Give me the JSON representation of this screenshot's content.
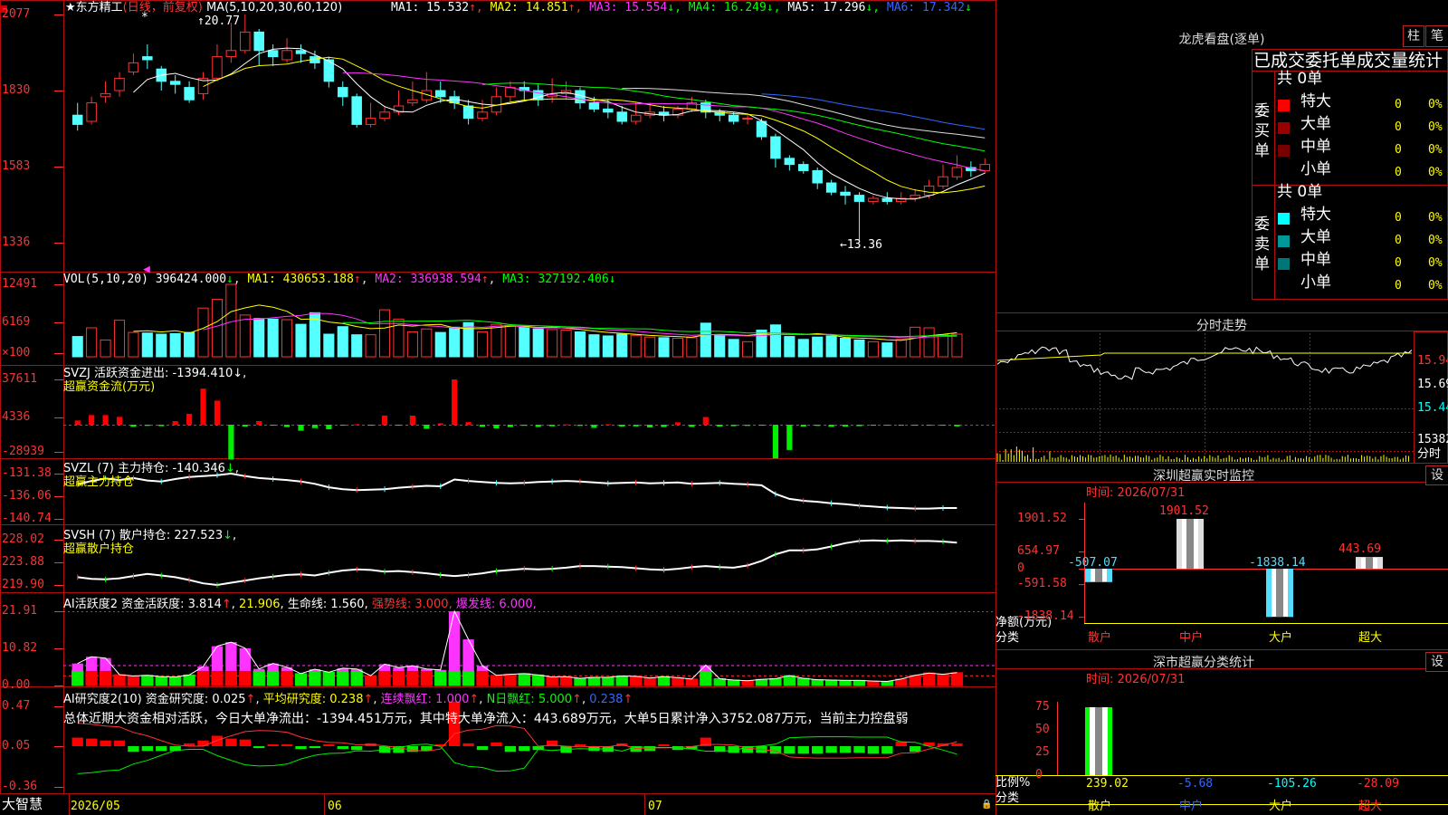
{
  "stock": {
    "star": "★",
    "name": "东方精工",
    "period": "(日线，前复权)",
    "ma_title": "MA(5,10,20,30,60,120)",
    "ma": [
      {
        "label": "MA1:",
        "value": "15.532",
        "arrow": "↑",
        "color": "#ffffff"
      },
      {
        "label": "MA2:",
        "value": "14.851",
        "arrow": "↑",
        "color": "#ffff00"
      },
      {
        "label": "MA3:",
        "value": "15.554",
        "arrow": "↓",
        "color": "#ff33ff"
      },
      {
        "label": "MA4:",
        "value": "16.249",
        "arrow": "↓",
        "color": "#00ff00"
      },
      {
        "label": "MA5:",
        "value": "17.296",
        "arrow": "↓",
        "color": "#ffffff"
      },
      {
        "label": "MA6:",
        "value": "17.342",
        "arrow": "↓",
        "color": "#3366ff"
      }
    ],
    "high_label": "20.77",
    "low_label": "13.36"
  },
  "price_axis": [
    "2077",
    "1830",
    "1583",
    "1336"
  ],
  "vol": {
    "title": "VOL(5,10,20)",
    "v": "396424.000",
    "ma1": "MA1: 430653.188",
    "ma2": "MA2: 336938.594",
    "ma3": "MA3: 327192.406",
    "axis": [
      "12491",
      "6169",
      "×100"
    ]
  },
  "svzj": {
    "title": "SVZJ  活跃资金进出: -1394.410",
    "sub": "超赢资金流(万元)",
    "axis": [
      "37611",
      "4336",
      "-28939"
    ]
  },
  "svzl": {
    "title": "SVZL (7) 主力持仓: -140.346",
    "sub": "超赢主力持仓",
    "axis": [
      "-131.38",
      "-136.06",
      "-140.74"
    ]
  },
  "svsh": {
    "title": "SVSH (7) 散户持仓: 227.523",
    "sub": "超赢散户持仓",
    "axis": [
      "228.02",
      "223.88",
      "219.90"
    ]
  },
  "ai1": {
    "title": "AI活跃度2 资金活跃度: 3.814",
    "v2": "21.906",
    "life": "生命线: 1.560",
    "strong": "强势线: 3.000",
    "burst": "爆发线: 6.000",
    "axis": [
      "21.91",
      "10.82",
      "0.00"
    ]
  },
  "ai2": {
    "title": "AI研究度2(10) 资金研究度: 0.025",
    "avg": "平均研究度: 0.238",
    "lian": "连续飘红: 1.000",
    "nday": "N日飘红: 5.000",
    "last": "0.238",
    "note": "总体近期大资金相对活跃，今日大单净流出：-1394.451万元，其中特大单净流入：443.689万元，大单5日累计净入3752.087万元，当前主力控盘弱",
    "axis": [
      "0.47",
      "0.05",
      "-0.36"
    ]
  },
  "dates": [
    "2026/05",
    "06",
    "07"
  ],
  "brand": "大智慧",
  "right": {
    "lhkp_title": "龙虎看盘(逐单)",
    "btn_zhu": "柱",
    "btn_bi": "笔",
    "stats_title": "已成交委托单成交量统计",
    "buy_label": "委买单",
    "sell_label": "委卖单",
    "buy_total": "共 0单",
    "sell_total": "共 0单",
    "buy_rows": [
      {
        "name": "特大",
        "count": "0",
        "pct": "0%",
        "color": "#ff0000"
      },
      {
        "name": "大单",
        "count": "0",
        "pct": "0%",
        "color": "#990000"
      },
      {
        "name": "中单",
        "count": "0",
        "pct": "0%",
        "color": "#770000"
      },
      {
        "name": "小单",
        "count": "0",
        "pct": "0%",
        "color": ""
      }
    ],
    "sell_rows": [
      {
        "name": "特大",
        "count": "0",
        "pct": "0%",
        "color": "#00ffff"
      },
      {
        "name": "大单",
        "count": "0",
        "pct": "0%",
        "color": "#009999"
      },
      {
        "name": "中单",
        "count": "0",
        "pct": "0%",
        "color": "#007777"
      },
      {
        "name": "小单",
        "count": "0",
        "pct": "0%",
        "color": ""
      }
    ],
    "fenshi_title": "分时走势",
    "fenshi_axis": [
      "15.94",
      "15.69",
      "15.44",
      "15382",
      "分时"
    ],
    "sz_title": "深圳超赢实时监控",
    "sz_set": "设",
    "sz_time": "时间: 2026/07/31",
    "sz_axis": [
      "1901.52",
      "654.97",
      "0",
      "-591.58",
      "-1838.14"
    ],
    "sz_ylab": "净额(万元)",
    "sz_xlab": "分类",
    "cls_title": "深市超赢分类统计",
    "cls_set": "设",
    "cls_time": "时间: 2026/07/31",
    "cls_axis": [
      "75",
      "50",
      "25",
      "0"
    ],
    "cls_ylab": "比例%",
    "cls_xlab": "分类",
    "categories": [
      "散户",
      "中户",
      "大户",
      "超大"
    ]
  },
  "chart_data": [
    {
      "type": "bar",
      "title": "深圳超赢实时监控",
      "categories": [
        "散户",
        "中户",
        "大户",
        "超大"
      ],
      "values": [
        -507.07,
        1901.52,
        -1838.14,
        443.69
      ],
      "value_labels": [
        "-507.07",
        "1901.52",
        "-1838.14",
        "443.69"
      ],
      "ylim": [
        -1838.14,
        1901.52
      ]
    },
    {
      "type": "bar",
      "title": "深市超赢分类统计",
      "categories": [
        "散户",
        "中户",
        "大户",
        "超大"
      ],
      "values": [
        239.02,
        -5.68,
        -105.26,
        -28.09
      ],
      "value_labels": [
        "239.02",
        "-5.68",
        "-105.26",
        "-28.09"
      ],
      "ylim": [
        0,
        75
      ]
    },
    {
      "type": "candlestick",
      "series": [
        {
          "name": "K",
          "values": [
            [
              17.5,
              17.2,
              17.9,
              17.0
            ],
            [
              17.3,
              17.9,
              18.1,
              17.2
            ],
            [
              18.1,
              18.2,
              18.6,
              17.9
            ],
            [
              18.3,
              18.7,
              18.9,
              18.1
            ],
            [
              18.9,
              19.2,
              19.5,
              18.8
            ],
            [
              19.4,
              19.3,
              19.8,
              19.0
            ],
            [
              19.0,
              18.6,
              19.1,
              18.3
            ],
            [
              18.6,
              18.5,
              18.8,
              18.2
            ],
            [
              18.4,
              18.0,
              18.6,
              17.9
            ],
            [
              18.2,
              18.7,
              18.9,
              18.0
            ],
            [
              18.7,
              19.4,
              19.8,
              18.6
            ],
            [
              19.4,
              19.6,
              20.5,
              19.2
            ],
            [
              19.6,
              20.2,
              20.77,
              19.5
            ],
            [
              20.2,
              19.6,
              20.3,
              19.1
            ],
            [
              19.6,
              19.4,
              19.8,
              19.1
            ],
            [
              19.3,
              19.6,
              20.0,
              19.2
            ],
            [
              19.6,
              19.5,
              19.8,
              19.2
            ],
            [
              19.4,
              19.2,
              19.6,
              19.0
            ],
            [
              19.3,
              18.6,
              19.4,
              18.4
            ],
            [
              18.4,
              18.1,
              18.6,
              17.8
            ],
            [
              18.1,
              17.2,
              18.2,
              17.1
            ],
            [
              17.2,
              17.4,
              17.9,
              17.1
            ],
            [
              17.4,
              17.6,
              17.8,
              17.3
            ],
            [
              17.6,
              17.8,
              18.3,
              17.5
            ],
            [
              17.9,
              18.0,
              18.6,
              17.8
            ],
            [
              18.0,
              18.3,
              18.9,
              17.9
            ],
            [
              18.3,
              18.1,
              18.6,
              17.9
            ],
            [
              18.1,
              17.9,
              18.3,
              17.7
            ],
            [
              17.8,
              17.4,
              18.0,
              17.2
            ],
            [
              17.4,
              17.6,
              18.0,
              17.3
            ],
            [
              17.6,
              18.1,
              18.4,
              17.5
            ],
            [
              18.1,
              18.4,
              18.6,
              17.9
            ],
            [
              18.4,
              18.3,
              18.6,
              18.0
            ],
            [
              18.3,
              18.0,
              18.5,
              17.8
            ],
            [
              18.1,
              18.2,
              18.7,
              17.9
            ],
            [
              18.2,
              18.3,
              18.6,
              18.0
            ],
            [
              18.3,
              17.9,
              18.4,
              17.7
            ],
            [
              17.9,
              17.7,
              18.1,
              17.6
            ],
            [
              17.7,
              17.6,
              18.0,
              17.4
            ],
            [
              17.6,
              17.3,
              17.8,
              17.2
            ],
            [
              17.3,
              17.5,
              17.9,
              17.2
            ],
            [
              17.5,
              17.6,
              17.9,
              17.4
            ],
            [
              17.6,
              17.5,
              17.8,
              17.3
            ],
            [
              17.5,
              17.7,
              17.8,
              17.4
            ],
            [
              17.7,
              17.9,
              18.1,
              17.6
            ],
            [
              17.9,
              17.6,
              18.0,
              17.4
            ],
            [
              17.6,
              17.5,
              17.7,
              17.3
            ],
            [
              17.5,
              17.3,
              17.6,
              17.2
            ],
            [
              17.4,
              17.4,
              17.5,
              17.2
            ],
            [
              17.3,
              16.8,
              17.4,
              16.7
            ],
            [
              16.8,
              16.1,
              16.9,
              15.8
            ],
            [
              16.1,
              15.9,
              16.2,
              15.7
            ],
            [
              15.9,
              15.7,
              16.0,
              15.6
            ],
            [
              15.7,
              15.3,
              15.8,
              15.1
            ],
            [
              15.3,
              15.0,
              15.4,
              14.9
            ],
            [
              15.0,
              14.9,
              15.2,
              14.6
            ],
            [
              14.9,
              14.7,
              15.0,
              13.36
            ],
            [
              14.7,
              14.8,
              14.9,
              14.6
            ],
            [
              14.8,
              14.7,
              15.0,
              14.6
            ],
            [
              14.7,
              14.8,
              15.0,
              14.6
            ],
            [
              14.8,
              14.9,
              15.1,
              14.7
            ],
            [
              14.9,
              15.2,
              15.4,
              14.8
            ],
            [
              15.2,
              15.5,
              15.9,
              15.1
            ],
            [
              15.5,
              15.8,
              16.2,
              15.4
            ],
            [
              15.8,
              15.7,
              16.0,
              15.5
            ],
            [
              15.7,
              15.9,
              16.1,
              15.6
            ]
          ]
        }
      ]
    },
    {
      "type": "bar",
      "title": "VOL(5,10,20)",
      "values": [
        3500,
        5000,
        2900,
        6300,
        4200,
        4100,
        3900,
        4000,
        4200,
        8400,
        9900,
        12491,
        7200,
        6600,
        6500,
        6400,
        5600,
        7600,
        3900,
        5200,
        3800,
        3800,
        8100,
        6500,
        4300,
        4800,
        4200,
        5100,
        5900,
        4300,
        5600,
        5400,
        5200,
        4800,
        4700,
        4600,
        4300,
        3800,
        3600,
        3900,
        3700,
        3400,
        3300,
        3200,
        3300,
        5800,
        3700,
        3000,
        2600,
        4600,
        5500,
        3500,
        3000,
        3400,
        3600,
        3200,
        2900,
        2600,
        2400,
        3000,
        5100,
        5000,
        3800,
        3900
      ]
    },
    {
      "type": "bar",
      "title": "SVZJ 活跃资金进出",
      "values": [
        3500,
        8000,
        8000,
        6500,
        -1800,
        -1000,
        -1200,
        3000,
        9000,
        30000,
        20000,
        -28939,
        -1500,
        3000,
        -500,
        -2000,
        -5000,
        -2800,
        -3800,
        -200,
        400,
        -100,
        7600,
        -200,
        7500,
        -3400,
        1200,
        37611,
        2200,
        -1800,
        -3000,
        -2000,
        -900,
        -1900,
        -1300,
        300,
        -1000,
        -2600,
        400,
        -1500,
        -1400,
        -2300,
        -2000,
        2000,
        -1900,
        6400,
        -1500,
        -1200,
        -1000,
        -500,
        -28000,
        -21000,
        -1500,
        -1000,
        -1800,
        -1600,
        -1200,
        -800,
        -500,
        -400,
        -300,
        -200,
        -100,
        -1394
      ]
    },
    {
      "type": "line",
      "title": "SVZL 主力持仓",
      "values": [
        -133.6,
        -132.9,
        -132.4,
        -132.7,
        -132.3,
        -132.8,
        -133.0,
        -132.5,
        -132.1,
        -131.9,
        -131.7,
        -131.38,
        -131.9,
        -132.3,
        -132.5,
        -132.7,
        -133.0,
        -133.5,
        -134.2,
        -134.6,
        -134.8,
        -134.7,
        -134.6,
        -134.3,
        -134.1,
        -133.9,
        -134.0,
        -132.6,
        -132.9,
        -133.1,
        -133.3,
        -133.4,
        -133.3,
        -133.1,
        -133.0,
        -132.9,
        -133.0,
        -133.2,
        -133.4,
        -133.3,
        -133.2,
        -133.4,
        -133.3,
        -133.2,
        -133.5,
        -133.4,
        -133.3,
        -133.5,
        -133.6,
        -133.8,
        -135.6,
        -136.6,
        -137.0,
        -137.2,
        -137.5,
        -137.7,
        -138.0,
        -138.2,
        -138.4,
        -138.5,
        -138.6,
        -138.6,
        -138.5,
        -138.5
      ]
    },
    {
      "type": "line",
      "title": "SVSH 散户持仓",
      "values": [
        221.3,
        221.0,
        220.9,
        221.1,
        221.5,
        221.9,
        221.6,
        221.3,
        220.8,
        220.2,
        219.9,
        220.3,
        220.7,
        221.1,
        221.4,
        221.7,
        221.8,
        221.6,
        222.1,
        222.5,
        222.7,
        222.6,
        222.3,
        222.4,
        222.2,
        222.0,
        221.7,
        221.5,
        221.7,
        222.0,
        222.4,
        222.6,
        222.8,
        222.7,
        222.8,
        223.0,
        223.3,
        223.3,
        223.2,
        223.1,
        222.9,
        222.7,
        222.6,
        222.8,
        223.1,
        223.3,
        223.1,
        223.0,
        223.4,
        224.2,
        225.4,
        226.1,
        226.1,
        226.3,
        226.8,
        227.4,
        227.8,
        227.9,
        227.8,
        227.9,
        227.8,
        227.8,
        227.7,
        227.5
      ]
    },
    {
      "type": "bar",
      "title": "AI活跃度2 资金活跃度",
      "values": [
        6.5,
        8.5,
        8.1,
        3.2,
        2.8,
        3.0,
        2.6,
        2.5,
        3.1,
        5.6,
        11.6,
        12.8,
        11.0,
        4.9,
        6.5,
        5.4,
        3.5,
        4.8,
        3.9,
        5.1,
        4.9,
        2.9,
        6.3,
        5.3,
        5.8,
        4.9,
        4.6,
        21.91,
        13.6,
        5.8,
        3.0,
        3.3,
        3.5,
        3.1,
        2.5,
        2.6,
        2.1,
        2.4,
        2.4,
        2.8,
        2.7,
        2.2,
        2.6,
        2.3,
        1.9,
        6.0,
        2.0,
        1.6,
        1.4,
        1.8,
        2.0,
        2.9,
        2.1,
        1.7,
        1.6,
        1.5,
        1.5,
        1.3,
        1.2,
        1.9,
        3.0,
        3.7,
        3.3,
        3.8
      ]
    },
    {
      "type": "bar",
      "title": "AI研究度2(10) 资金研究度",
      "values": [
        0.09,
        0.08,
        0.06,
        0.06,
        -0.06,
        -0.05,
        -0.05,
        -0.05,
        0.03,
        0.06,
        0.11,
        0.08,
        0.07,
        -0.02,
        0.02,
        0.02,
        -0.03,
        -0.02,
        0.02,
        -0.03,
        -0.04,
        0.03,
        -0.07,
        -0.07,
        -0.06,
        -0.05,
        0.02,
        0.47,
        0.03,
        -0.04,
        0.04,
        -0.06,
        -0.05,
        -0.04,
        0.06,
        -0.07,
        0.02,
        -0.05,
        -0.06,
        0.03,
        -0.06,
        -0.05,
        0.02,
        -0.04,
        -0.03,
        0.09,
        -0.06,
        -0.07,
        -0.07,
        -0.07,
        -0.08,
        -0.08,
        -0.08,
        -0.08,
        -0.07,
        -0.07,
        -0.07,
        -0.08,
        -0.08,
        0.05,
        -0.06,
        0.04,
        0.03,
        0.03
      ]
    }
  ]
}
